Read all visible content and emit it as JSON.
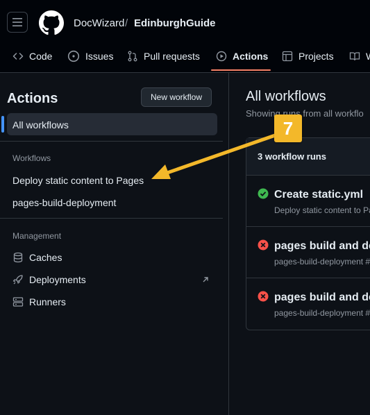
{
  "header": {
    "owner": "DocWizard",
    "separator": "/",
    "repo": "EdinburghGuide"
  },
  "tabs": [
    {
      "label": "Code",
      "icon": "code-icon"
    },
    {
      "label": "Issues",
      "icon": "issue-icon"
    },
    {
      "label": "Pull requests",
      "icon": "pull-request-icon"
    },
    {
      "label": "Actions",
      "icon": "play-icon",
      "selected": true
    },
    {
      "label": "Projects",
      "icon": "table-icon"
    },
    {
      "label": "W",
      "icon": "book-icon"
    }
  ],
  "sidebar": {
    "title": "Actions",
    "new_workflow": "New workflow",
    "all_workflows": "All workflows",
    "workflows_label": "Workflows",
    "workflows": [
      "Deploy static content to Pages",
      "pages-build-deployment"
    ],
    "management_label": "Management",
    "management": [
      {
        "label": "Caches",
        "icon": "database-icon"
      },
      {
        "label": "Deployments",
        "icon": "rocket-icon",
        "external": true
      },
      {
        "label": "Runners",
        "icon": "server-icon"
      }
    ]
  },
  "main": {
    "title": "All workflows",
    "subtitle": "Showing runs from all workflo",
    "runs_count": "3 workflow runs",
    "runs": [
      {
        "title": "Create static.yml",
        "sub": "Deploy static content to Pa",
        "status": "success"
      },
      {
        "title": "pages build and de",
        "sub": "pages-build-deployment #",
        "status": "failure"
      },
      {
        "title": "pages build and de",
        "sub": "pages-build-deployment #",
        "status": "failure"
      }
    ]
  },
  "callout": {
    "step": "7"
  },
  "colors": {
    "accent": "#f78166",
    "selected_bar": "#4493f8",
    "success": "#3fb950",
    "failure": "#f85149",
    "callout": "#f3b82a"
  }
}
